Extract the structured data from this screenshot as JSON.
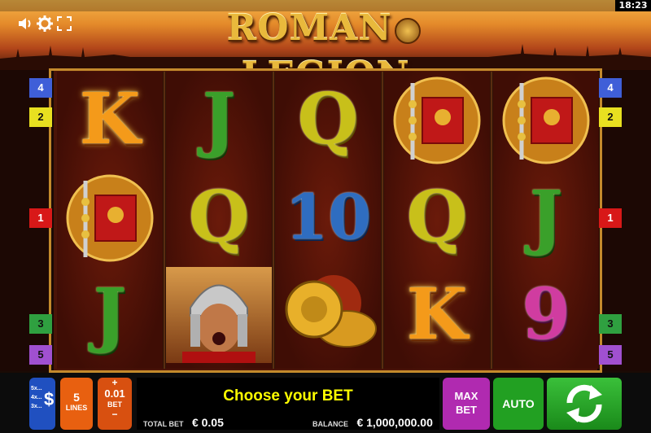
{
  "status_bar": {
    "time": "18:23"
  },
  "game": {
    "title": "ROMAN LEGION",
    "title_left": "ROMAN",
    "title_right": "LEGION"
  },
  "top_icons": [
    "speaker-icon",
    "gear-icon",
    "fullscreen-icon"
  ],
  "side_markers": {
    "left": [
      {
        "label": "4",
        "color": "#3f5fd8"
      },
      {
        "label": "2",
        "color": "#e8e020"
      },
      {
        "label": "1",
        "color": "#d81818"
      },
      {
        "label": "3",
        "color": "#2fa040"
      },
      {
        "label": "5",
        "color": "#a050d0"
      }
    ],
    "right": [
      {
        "label": "4",
        "color": "#3f5fd8"
      },
      {
        "label": "2",
        "color": "#e8e020"
      },
      {
        "label": "1",
        "color": "#d81818"
      },
      {
        "label": "3",
        "color": "#2fa040"
      },
      {
        "label": "5",
        "color": "#a050d0"
      }
    ]
  },
  "reels": [
    [
      "K",
      "banner",
      "J"
    ],
    [
      "J",
      "Q",
      "legionary"
    ],
    [
      "Q",
      "10",
      "coin"
    ],
    [
      "banner",
      "Q",
      "K"
    ],
    [
      "banner",
      "J",
      "9"
    ]
  ],
  "symbol_text": {
    "K": "K",
    "J": "J",
    "Q": "Q",
    "10": "10",
    "9": "9"
  },
  "controls": {
    "paytable": {
      "lines": [
        "5x...",
        "4x...",
        "3x..."
      ],
      "icon": "dollar-icon",
      "symbol": "$"
    },
    "lines": {
      "value": "5",
      "label": "LINES"
    },
    "bet": {
      "plus": "+",
      "value": "0.01",
      "label": "BET",
      "minus": "−"
    },
    "message": "Choose your BET",
    "total_bet": {
      "label": "TOTAL BET",
      "value": "€ 0.05"
    },
    "balance": {
      "label": "BALANCE",
      "value": "€ 1,000,000.00"
    },
    "max_bet": {
      "line1": "MAX",
      "line2": "BET"
    },
    "auto": "AUTO",
    "spin_icon": "spin-arrows-icon"
  },
  "colors": {
    "max_bet": "#b02ab0",
    "auto": "#22a022",
    "spin": "#22a022",
    "lines": "#e86010",
    "bet": "#d85010",
    "paytable": "#2050c0",
    "message": "#ffff00"
  }
}
